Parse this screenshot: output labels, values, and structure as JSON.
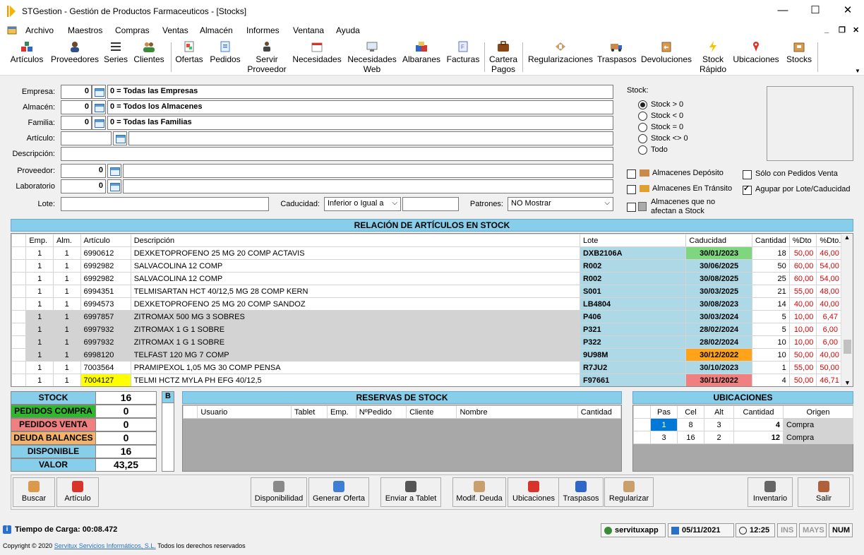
{
  "window": {
    "title": "STGestion - Gestión de Productos Farmaceuticos - [Stocks]",
    "minimize": "—",
    "maximize": "☐",
    "close": "✕"
  },
  "menu": [
    "Archivo",
    "Maestros",
    "Compras",
    "Ventas",
    "Almacén",
    "Informes",
    "Ventana",
    "Ayuda"
  ],
  "mdi": {
    "min": "_",
    "restore": "❐",
    "close": "✕"
  },
  "toolbar": [
    {
      "label": "Artículos",
      "icon": "articulos-icon"
    },
    {
      "label": "Proveedores",
      "icon": "proveedores-icon"
    },
    {
      "label": "Series",
      "icon": "series-icon"
    },
    {
      "label": "Clientes",
      "icon": "clientes-icon"
    },
    {
      "label": "Ofertas",
      "icon": "ofertas-icon"
    },
    {
      "label": "Pedidos",
      "icon": "pedidos-icon"
    },
    {
      "label": "Servir",
      "label2": "Proveedor",
      "icon": "servir-proveedor-icon"
    },
    {
      "label": "Necesidades",
      "icon": "necesidades-icon"
    },
    {
      "label": "Necesidades",
      "label2": "Web",
      "icon": "necesidades-web-icon"
    },
    {
      "label": "Albaranes",
      "icon": "albaranes-icon"
    },
    {
      "label": "Facturas",
      "icon": "facturas-icon"
    },
    {
      "label": "Cartera",
      "label2": "Pagos",
      "icon": "cartera-pagos-icon"
    },
    {
      "label": "Regularizaciones",
      "icon": "regularizaciones-icon"
    },
    {
      "label": "Traspasos",
      "icon": "traspasos-icon"
    },
    {
      "label": "Devoluciones",
      "icon": "devoluciones-icon"
    },
    {
      "label": "Stock",
      "label2": "Rápido",
      "icon": "stock-rapido-icon"
    },
    {
      "label": "Ubicaciones",
      "icon": "ubicaciones-icon"
    },
    {
      "label": "Stocks",
      "icon": "stocks-icon"
    }
  ],
  "form": {
    "empresa_label": "Empresa:",
    "empresa_code": "0",
    "empresa_name": "0 = Todas las Empresas",
    "almacen_label": "Almacén:",
    "almacen_code": "0",
    "almacen_name": "0 = Todos los Almacenes",
    "familia_label": "Familia:",
    "familia_code": "0",
    "familia_name": "0 = Todas las Familias",
    "articulo_label": "Artículo:",
    "descripcion_label": "Descripción:",
    "proveedor_label": "Proveedor:",
    "proveedor_code": "0",
    "laboratorio_label": "Laboratorio",
    "laboratorio_code": "0",
    "lote_label": "Lote:",
    "caducidad_label": "Caducidad:",
    "caducidad_option": "Inferior o Igual a",
    "patrones_label": "Patrones:",
    "patrones_option": "NO Mostrar"
  },
  "stock_filter": {
    "label": "Stock:",
    "options": [
      "Stock > 0",
      "Stock < 0",
      "Stock = 0",
      "Stock <> 0",
      "Todo"
    ],
    "selected": 0
  },
  "checks": {
    "deposito": "Almacenes Depósito",
    "transito": "Almacenes En Tránsito",
    "noafectan1": "Almacenes que no",
    "noafectan2": "afectan a Stock",
    "pedidos_venta": "Sólo con Pedidos Venta",
    "agrupar": "Agupar por Lote/Caducidad"
  },
  "stock_list": {
    "title": "RELACIÓN DE ARTÍCULOS EN STOCK",
    "columns": [
      "Emp.",
      "Alm.",
      "Artículo",
      "Descripción",
      "Lote",
      "Caducidad",
      "Cantidad",
      "%Dto",
      "%Dto.M"
    ],
    "rows": [
      {
        "emp": "1",
        "alm": "1",
        "art": "6990612",
        "desc": "DEXKETOPROFENO 25 MG 20 COMP ACTAVIS",
        "lote": "DXB2106A",
        "cad": "30/01/2023",
        "cant": "18",
        "dto": "50,00",
        "dtom": "46,00",
        "shade": false,
        "cadcolor": "#7ed67e",
        "artcolor": ""
      },
      {
        "emp": "1",
        "alm": "1",
        "art": "6992982",
        "desc": "SALVACOLINA 12 COMP",
        "lote": "R002",
        "cad": "30/06/2025",
        "cant": "50",
        "dto": "60,00",
        "dtom": "54,00",
        "shade": false,
        "cadcolor": "",
        "artcolor": ""
      },
      {
        "emp": "1",
        "alm": "1",
        "art": "6992982",
        "desc": "SALVACOLINA 12 COMP",
        "lote": "R002",
        "cad": "30/08/2025",
        "cant": "25",
        "dto": "60,00",
        "dtom": "54,00",
        "shade": false,
        "cadcolor": "",
        "artcolor": ""
      },
      {
        "emp": "1",
        "alm": "1",
        "art": "6994351",
        "desc": "TELMISARTAN HCT 40/12,5 MG 28 COMP KERN",
        "lote": "S001",
        "cad": "30/03/2025",
        "cant": "21",
        "dto": "55,00",
        "dtom": "48,00",
        "shade": false,
        "cadcolor": "",
        "artcolor": ""
      },
      {
        "emp": "1",
        "alm": "1",
        "art": "6994573",
        "desc": "DEXKETOPROFENO 25 MG 20 COMP SANDOZ",
        "lote": "LB4804",
        "cad": "30/08/2023",
        "cant": "14",
        "dto": "40,00",
        "dtom": "40,00",
        "shade": false,
        "cadcolor": "",
        "artcolor": ""
      },
      {
        "emp": "1",
        "alm": "1",
        "art": "6997857",
        "desc": "ZITROMAX 500 MG 3 SOBRES",
        "lote": "P406",
        "cad": "30/03/2024",
        "cant": "5",
        "dto": "10,00",
        "dtom": "6,47",
        "shade": true,
        "cadcolor": "",
        "artcolor": ""
      },
      {
        "emp": "1",
        "alm": "1",
        "art": "6997932",
        "desc": "ZITROMAX 1 G 1 SOBRE",
        "lote": "P321",
        "cad": "28/02/2024",
        "cant": "5",
        "dto": "10,00",
        "dtom": "6,00",
        "shade": true,
        "cadcolor": "",
        "artcolor": ""
      },
      {
        "emp": "1",
        "alm": "1",
        "art": "6997932",
        "desc": "ZITROMAX 1 G 1 SOBRE",
        "lote": "P322",
        "cad": "28/02/2024",
        "cant": "10",
        "dto": "10,00",
        "dtom": "6,00",
        "shade": true,
        "cadcolor": "",
        "artcolor": ""
      },
      {
        "emp": "1",
        "alm": "1",
        "art": "6998120",
        "desc": "TELFAST 120 MG 7 COMP",
        "lote": "9U98M",
        "cad": "30/12/2022",
        "cant": "10",
        "dto": "50,00",
        "dtom": "40,00",
        "shade": true,
        "cadcolor": "#ffa31a",
        "artcolor": ""
      },
      {
        "emp": "1",
        "alm": "1",
        "art": "7003564",
        "desc": "PRAMIPEXOL 1,05 MG 30 COMP PENSA",
        "lote": "R7JU2",
        "cad": "30/10/2023",
        "cant": "1",
        "dto": "55,00",
        "dtom": "50,00",
        "shade": false,
        "cadcolor": "",
        "artcolor": ""
      },
      {
        "emp": "1",
        "alm": "1",
        "art": "7004127",
        "desc": "TELMI HCTZ MYLA PH EFG 40/12,5",
        "lote": "F97661",
        "cad": "30/11/2022",
        "cant": "4",
        "dto": "50,00",
        "dtom": "46,71",
        "shade": false,
        "cadcolor": "#f08080",
        "artcolor": "#ffff00"
      }
    ]
  },
  "summary": {
    "rows": [
      {
        "label": "STOCK",
        "value": "16",
        "color": "#87ceeb"
      },
      {
        "label": "PEDIDOS COMPRA",
        "value": "0",
        "color": "#2eb82e"
      },
      {
        "label": "PEDIDOS VENTA",
        "value": "0",
        "color": "#f08080"
      },
      {
        "label": "DEUDA BALANCES",
        "value": "0",
        "color": "#f5b26b"
      },
      {
        "label": "DISPONIBLE",
        "value": "16",
        "color": "#87ceeb"
      },
      {
        "label": "VALOR",
        "value": "43,25",
        "color": "#87ceeb"
      }
    ],
    "b_label": "B"
  },
  "reservas": {
    "title": "RESERVAS DE STOCK",
    "columns": [
      "Usuario",
      "Tablet",
      "Emp.",
      "NºPedido",
      "Cliente",
      "Nombre",
      "Cantidad"
    ]
  },
  "ubicaciones": {
    "title": "UBICACIONES",
    "columns": [
      "Pas",
      "Cel",
      "Alt",
      "Cantidad",
      "Origen"
    ],
    "rows": [
      {
        "pas": "1",
        "cel": "8",
        "alt": "3",
        "cant": "4",
        "origen": "Compra"
      },
      {
        "pas": "3",
        "cel": "16",
        "alt": "2",
        "cant": "12",
        "origen": "Compra"
      }
    ]
  },
  "buttons": [
    "Buscar",
    "Artículo",
    "Disponibilidad",
    "Generar Oferta",
    "Enviar a Tablet",
    "Modif. Deuda",
    "Ubicaciones",
    "Traspasos",
    "Regularizar",
    "Inventario",
    "Salir"
  ],
  "status": {
    "load": "Tiempo de Carga: 00:08.472",
    "user": "servituxapp",
    "date": "05/11/2021",
    "time": "12:25",
    "ins": "INS",
    "mays": "MAYS",
    "num": "NUM"
  },
  "copyright": {
    "prefix": "Copyright © 2020",
    "company": "Servitux Servicios Informáticos, S.L.",
    "suffix": "Todos los derechos reservados"
  }
}
